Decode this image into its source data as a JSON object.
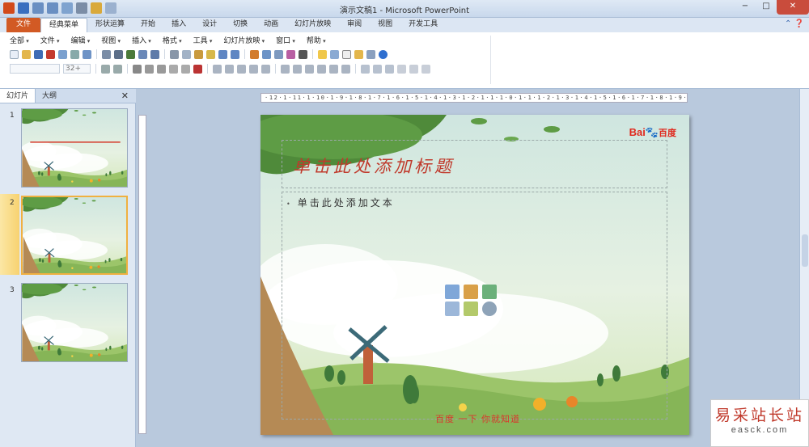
{
  "window": {
    "title": "演示文稿1 - Microsoft PowerPoint",
    "controls": [
      "−",
      "□",
      "✕"
    ]
  },
  "ribbon": {
    "tabs": [
      "文件",
      "经典菜单",
      "形状运算",
      "开始",
      "插入",
      "设计",
      "切换",
      "动画",
      "幻灯片放映",
      "审阅",
      "视图",
      "开发工具"
    ],
    "active_tab": "经典菜单",
    "menus": [
      "全部",
      "文件",
      "编辑",
      "视图",
      "插入",
      "格式",
      "工具",
      "幻灯片放映",
      "窗口",
      "帮助"
    ],
    "font_size_value": "32+"
  },
  "left_pane": {
    "tabs": [
      "幻灯片",
      "大纲"
    ],
    "close": "✕",
    "slides": [
      {
        "number": "1"
      },
      {
        "number": "2"
      },
      {
        "number": "3"
      }
    ]
  },
  "slide": {
    "title": "单击此处添加标题",
    "body": "单击此处添加文本",
    "bullet": "•",
    "logo": {
      "bai": "Bai",
      "paw": "🐾",
      "du": "百度"
    },
    "footer": "百度 一下 你就知道"
  },
  "ruler": {
    "horizontal": "·12·1·11·1·10·1·9·1·8·1·7·1·6·1·5·1·4·1·3·1·2·1·1·1·0·1·1·1·2·1·3·1·4·1·5·1·6·1·7·1·8·1·9·1·10·1·11·1·12·"
  },
  "watermark": {
    "cn": "易采站长站",
    "en": "easck.com"
  },
  "colors": {
    "file_tab": "#d25a24",
    "title_red": "#c0392b",
    "selection": "#f0b040"
  }
}
